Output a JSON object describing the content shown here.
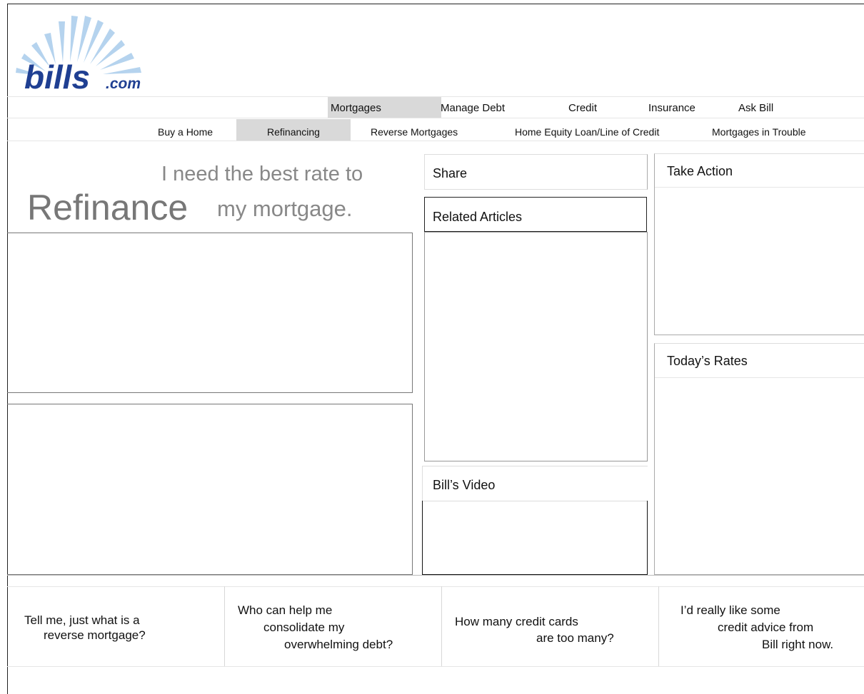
{
  "brand": {
    "logo_text": "bills",
    "logo_suffix": ".com"
  },
  "primary_nav": [
    "Mortgages",
    "Manage Debt",
    "Credit",
    "Insurance",
    "Ask Bill"
  ],
  "secondary_nav": [
    "Buy a Home",
    "Refinancing",
    "Reverse Mortgages",
    "Home Equity Loan/Line of Credit",
    "Mortgages in Trouble"
  ],
  "hero": {
    "line1": "I need the best rate to",
    "big_word": "Refinance",
    "rest": "my mortgage."
  },
  "panels": {
    "share": "Share",
    "related": "Related Articles",
    "video": "Bill’s Video",
    "action": "Take Action",
    "rates": "Today’s Rates"
  },
  "questions": [
    [
      "Tell me, just what is a",
      "reverse mortgage?"
    ],
    [
      "Who can help me",
      "consolidate my",
      "overwhelming debt?"
    ],
    [
      "How many credit cards",
      "are too many?"
    ],
    [
      "I’d really like some",
      "credit advice from",
      "Bill right now."
    ]
  ],
  "colors": {
    "brand_blue": "#1f3f92",
    "ray_blue": "#b5d3ee",
    "nav_highlight": "#d9d9d9",
    "hero_gray": "#888888"
  }
}
